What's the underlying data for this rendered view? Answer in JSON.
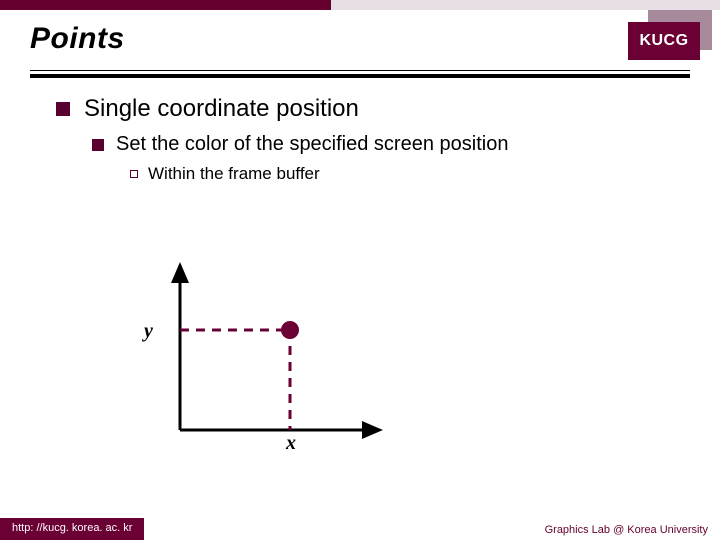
{
  "header": {
    "title": "Points",
    "badge": "KUCG"
  },
  "bullets": {
    "level1": "Single coordinate position",
    "level2": "Set the color of the specified screen position",
    "level3": "Within the frame buffer"
  },
  "diagram": {
    "x_label": "x",
    "y_label": "y"
  },
  "footer": {
    "url": "http: //kucg. korea. ac. kr",
    "attribution": "Graphics Lab @ Korea University"
  },
  "chart_data": {
    "type": "scatter",
    "title": "",
    "xlabel": "x",
    "ylabel": "y",
    "xlim": [
      0,
      1
    ],
    "ylim": [
      0,
      1
    ],
    "series": [
      {
        "name": "point",
        "x": [
          0.55
        ],
        "y": [
          0.62
        ]
      }
    ],
    "annotations": [
      "dashed guide lines from point to axes"
    ]
  },
  "colors": {
    "brand": "#6b0034",
    "brand_light": "#a6899a"
  }
}
